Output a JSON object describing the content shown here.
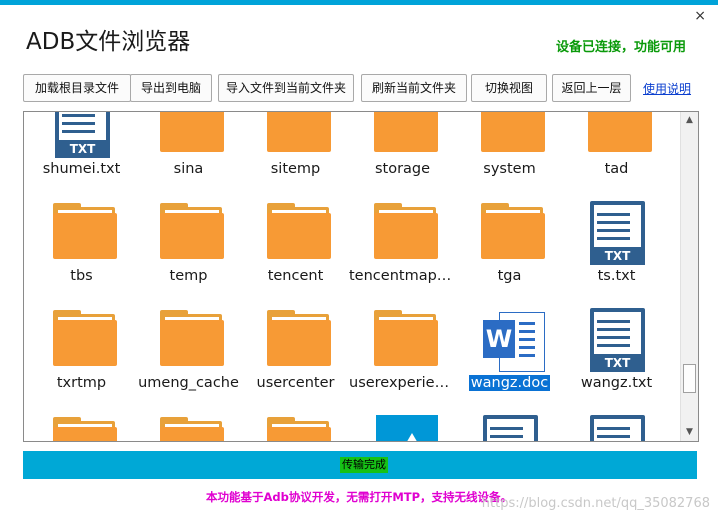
{
  "window": {
    "title": "ADB文件浏览器",
    "status": "设备已连接，功能可用",
    "close_glyph": "×"
  },
  "toolbar": {
    "buttons": [
      {
        "label": "加载根目录文件"
      },
      {
        "label": "导出到电脑"
      },
      {
        "label": "导入文件到当前文件夹"
      },
      {
        "label": "刷新当前文件夹"
      },
      {
        "label": "切换视图"
      },
      {
        "label": "返回上一层"
      }
    ],
    "help_link": "使用说明"
  },
  "files": [
    {
      "name": "shumei.txt",
      "type": "txt"
    },
    {
      "name": "sina",
      "type": "folder"
    },
    {
      "name": "sitemp",
      "type": "folder"
    },
    {
      "name": "storage",
      "type": "folder"
    },
    {
      "name": "system",
      "type": "folder"
    },
    {
      "name": "tad",
      "type": "folder"
    },
    {
      "name": "tbs",
      "type": "folder"
    },
    {
      "name": "temp",
      "type": "folder"
    },
    {
      "name": "tencent",
      "type": "folder"
    },
    {
      "name": "tencentmaps...",
      "type": "folder"
    },
    {
      "name": "tga",
      "type": "folder"
    },
    {
      "name": "ts.txt",
      "type": "txt"
    },
    {
      "name": "txrtmp",
      "type": "folder"
    },
    {
      "name": "umeng_cache",
      "type": "folder"
    },
    {
      "name": "usercenter",
      "type": "folder"
    },
    {
      "name": "userexperience",
      "type": "folder"
    },
    {
      "name": "wangz.doc",
      "type": "doc",
      "selected": true
    },
    {
      "name": "wangz.txt",
      "type": "txt"
    },
    {
      "name": "",
      "type": "folder"
    },
    {
      "name": "",
      "type": "folder"
    },
    {
      "name": "",
      "type": "folder"
    },
    {
      "name": "",
      "type": "image"
    },
    {
      "name": "",
      "type": "txt"
    },
    {
      "name": "",
      "type": "txt"
    }
  ],
  "txt_badge": "TXT",
  "word_letter": "W",
  "progress": {
    "text": "传输完成",
    "value": 1.0
  },
  "footer": "本功能基于Adb协议开发，无需打开MTP，支持无线设备。",
  "watermark": "https://blog.csdn.net/qq_35082768",
  "colors": {
    "accent": "#00a8d6",
    "status_green": "#0a9a0a",
    "footer_magenta": "#e000d0",
    "folder": "#f79a35",
    "txt": "#2f5f8f",
    "word": "#2b6cc4"
  }
}
